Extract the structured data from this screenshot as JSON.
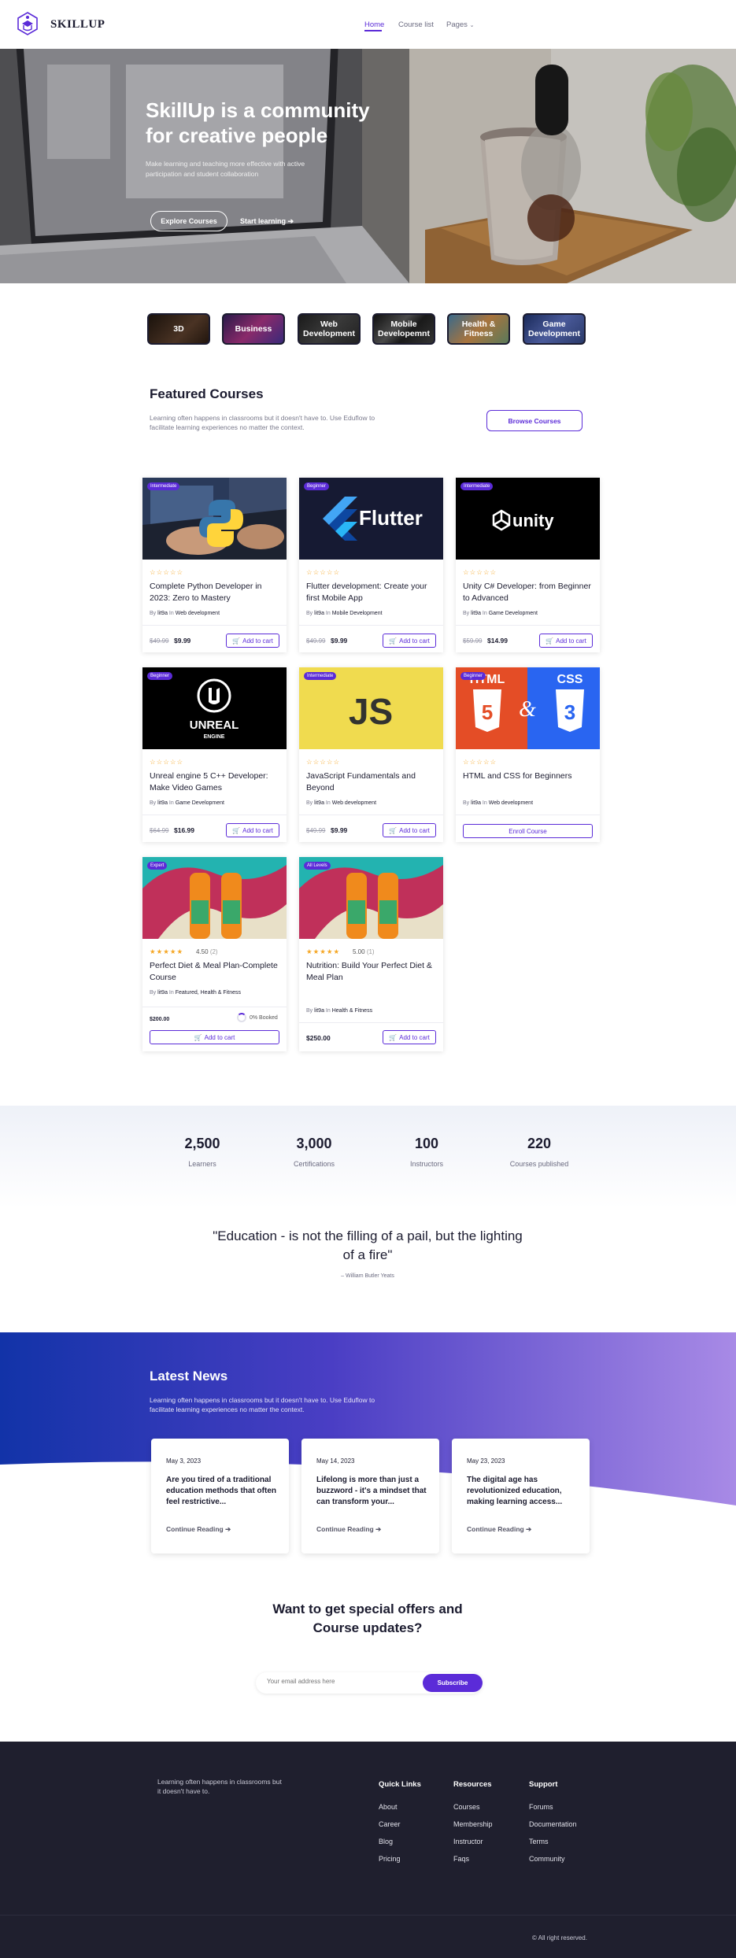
{
  "header": {
    "brand": "SKILLUP",
    "nav": [
      {
        "label": "Home",
        "active": true
      },
      {
        "label": "Course list",
        "active": false
      },
      {
        "label": "Pages",
        "active": false
      }
    ]
  },
  "hero": {
    "title_line1": "SkillUp is a community",
    "title_line2": "for creative people",
    "subtitle": "Make learning and teaching more effective with active participation and student collaboration",
    "explore_label": "Explore Courses",
    "start_label": "Start learning"
  },
  "categories": [
    {
      "label": "3D",
      "color": "#3b2a1e"
    },
    {
      "label": "Business",
      "color": "#5a2a6b"
    },
    {
      "label": "Web Development",
      "color": "#2b2b2b"
    },
    {
      "label": "Mobile Developemnt",
      "color": "#4a4a4a"
    },
    {
      "label": "Health & Fitness",
      "color": "#7a5a3a"
    },
    {
      "label": "Game Development",
      "color": "#2e3e6e"
    }
  ],
  "featured": {
    "title": "Featured Courses",
    "subtitle_line1": "Learning often happens in classrooms but it doesn't have to. Use Eduflow to",
    "subtitle_line2": "facilitate learning experiences no matter the context.",
    "browse_label": "Browse Courses"
  },
  "courses": [
    {
      "level": "Intermediate",
      "title": "Complete Python Developer in 2023: Zero to Mastery",
      "author": "lit9a",
      "category": "Web development",
      "old_price": "$49.99",
      "price": "$9.99",
      "action": "Add to cart",
      "stars": "☆☆☆☆☆"
    },
    {
      "level": "Beginner",
      "title": "Flutter development: Create your first Mobile App",
      "author": "lit9a",
      "category": "Mobile Development",
      "old_price": "$49.99",
      "price": "$9.99",
      "action": "Add to cart",
      "stars": "☆☆☆☆☆",
      "brand_text": "Flutter"
    },
    {
      "level": "Intermediate",
      "title": "Unity C# Developer: from Beginner to Advanced",
      "author": "lit9a",
      "category": "Game Development",
      "old_price": "$59.99",
      "price": "$14.99",
      "action": "Add to cart",
      "stars": "☆☆☆☆☆",
      "brand_text": "unity"
    },
    {
      "level": "Beginner",
      "title": "Unreal engine 5 C++ Developer: Make Video Games",
      "author": "lit9a",
      "category": "Game Development",
      "old_price": "$64.99",
      "price": "$16.99",
      "action": "Add to cart",
      "stars": "☆☆☆☆☆",
      "brand_text": "UNREAL",
      "brand_sub": "ENGINE"
    },
    {
      "level": "Intermediate",
      "title": "JavaScript Fundamentals and Beyond",
      "author": "lit9a",
      "category": "Web development",
      "old_price": "$49.99",
      "price": "$9.99",
      "action": "Add to cart",
      "stars": "☆☆☆☆☆",
      "brand_text": "JS"
    },
    {
      "level": "Beginner",
      "title": "HTML and CSS for Beginners",
      "author": "lit9a",
      "category": "Web development",
      "action": "Enroll Course",
      "stars": "☆☆☆☆☆",
      "brand_text": "HTML",
      "brand_text2": "CSS"
    },
    {
      "level": "Expert",
      "title": "Perfect Diet & Meal Plan-Complete Course",
      "author": "lit9a",
      "category": "Featured, Health & Fitness",
      "price": "$200.00",
      "booked": "0% Booked",
      "action": "Add to cart",
      "stars": "★★★★★",
      "rating": "4.50",
      "rating_count": "(2)"
    },
    {
      "level": "All Levels",
      "title": "Nutrition: Build Your Perfect Diet & Meal Plan",
      "author": "lit9a",
      "category": "Health & Fitness",
      "price": "$250.00",
      "action": "Add to cart",
      "stars": "★★★★★",
      "rating": "5.00",
      "rating_count": "(1)"
    }
  ],
  "by_label": "By",
  "in_label": "In",
  "stats": [
    {
      "value": "2,500",
      "label": "Learners"
    },
    {
      "value": "3,000",
      "label": "Certifications"
    },
    {
      "value": "100",
      "label": "Instructors"
    },
    {
      "value": "220",
      "label": "Courses published"
    }
  ],
  "quote": {
    "text": "\"Education - is not the filling of a pail, but the lighting of a fire\"",
    "author": "– William Butler Yeats"
  },
  "news": {
    "title": "Latest News",
    "subtitle_line1": "Learning often happens in classrooms but it doesn't have to. Use Eduflow to",
    "subtitle_line2": "facilitate learning experiences no matter the context.",
    "link_label": "Continue Reading",
    "items": [
      {
        "date": "May 3, 2023",
        "title": "Are you tired of a traditional education methods that often feel restrictive..."
      },
      {
        "date": "May 14, 2023",
        "title": "Lifelong is more than just a buzzword - it's a mindset that can transform your..."
      },
      {
        "date": "May 23, 2023",
        "title": "The digital age has revolutionized education, making learning access..."
      }
    ]
  },
  "subscribe": {
    "title_line1": "Want to get special offers and",
    "title_line2": "Course updates?",
    "placeholder": "Your email address here",
    "button": "Subscribe"
  },
  "footer": {
    "about": "Learning often happens in classrooms but it doesn't have to.",
    "columns": [
      {
        "heading": "Quick Links",
        "links": [
          "About",
          "Career",
          "Blog",
          "Pricing"
        ]
      },
      {
        "heading": "Resources",
        "links": [
          "Courses",
          "Membership",
          "Instructor",
          "Faqs"
        ]
      },
      {
        "heading": "Support",
        "links": [
          "Forums",
          "Documentation",
          "Terms",
          "Community"
        ]
      }
    ],
    "copyright": "© All right reserved."
  },
  "colors": {
    "accent": "#5b2bd8",
    "dark": "#1f1f2e",
    "star": "#f5a623"
  }
}
